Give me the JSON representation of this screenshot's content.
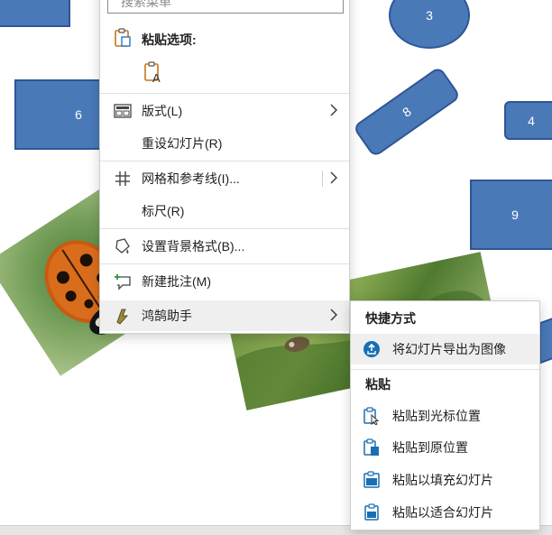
{
  "slide": {
    "shapes": [
      {
        "label": ""
      },
      {
        "label": "3"
      },
      {
        "label": "6"
      },
      {
        "label": "8"
      },
      {
        "label": "4"
      },
      {
        "label": "9"
      }
    ]
  },
  "context_menu": {
    "search_placeholder": "搜索菜单",
    "paste_options_label": "粘贴选项:",
    "items": [
      {
        "label": "版式(L)",
        "icon": "layout-icon"
      },
      {
        "label": "重设幻灯片(R)",
        "icon": ""
      },
      {
        "label": "网格和参考线(I)...",
        "icon": "grid-icon"
      },
      {
        "label": "标尺(R)",
        "icon": ""
      },
      {
        "label": "设置背景格式(B)...",
        "icon": "format-background-icon"
      },
      {
        "label": "新建批注(M)",
        "icon": "new-comment-icon"
      },
      {
        "label": "鸿鹄助手",
        "icon": "addin-icon"
      }
    ]
  },
  "submenu": {
    "shortcut_header": "快捷方式",
    "export_label": "将幻灯片导出为图像",
    "paste_header": "粘贴",
    "paste_items": [
      {
        "label": "粘贴到光标位置"
      },
      {
        "label": "粘贴到原位置"
      },
      {
        "label": "粘贴以填充幻灯片"
      },
      {
        "label": "粘贴以适合幻灯片"
      }
    ]
  },
  "colors": {
    "shape_fill": "#4a79b8",
    "shape_border": "#2f5597",
    "accent": "#1a6fb3"
  }
}
